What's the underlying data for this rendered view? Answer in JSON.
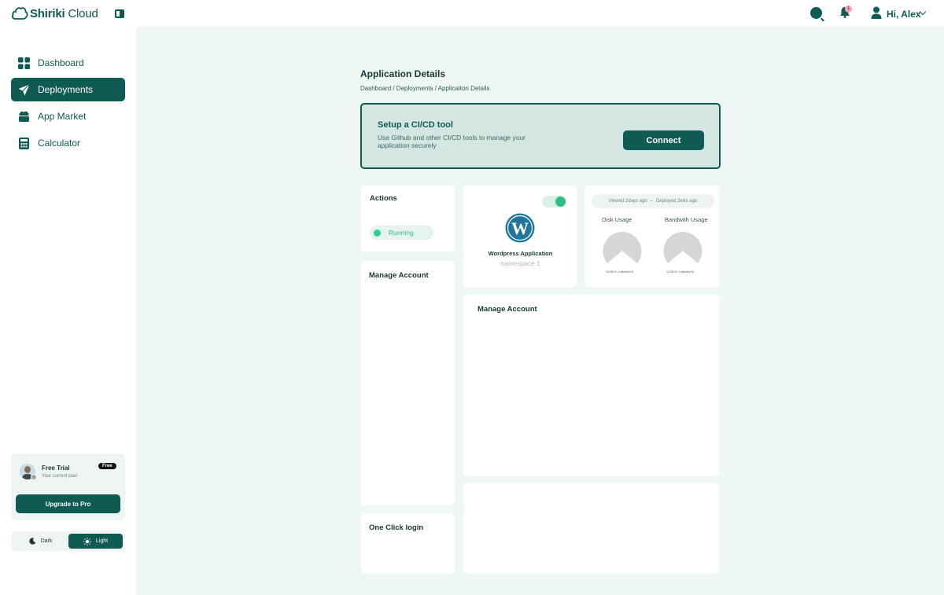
{
  "header": {
    "logo_text_bold": "Shiriki",
    "logo_text_light": " Cloud",
    "notification_count": "1",
    "greeting": "Hi, Alex"
  },
  "sidebar": {
    "items": [
      {
        "label": "Dashboard",
        "icon": "grid-icon",
        "active": false
      },
      {
        "label": "Deployments",
        "icon": "paper-plane-icon",
        "active": true
      },
      {
        "label": "App Market",
        "icon": "cloud-box-icon",
        "active": false
      },
      {
        "label": "Calculator",
        "icon": "calculator-icon",
        "active": false
      }
    ],
    "plan": {
      "name": "Free Trial",
      "subtitle": "Your current plan",
      "badge": "Free",
      "upgrade_label": "Upgrade to Pro"
    },
    "theme": {
      "dark_label": "Dark",
      "light_label": "Light",
      "selected": "Light"
    }
  },
  "page": {
    "title": "Application Details",
    "breadcrumb": "Dashboard / Deployments / Applicaiton Details"
  },
  "cicd": {
    "title": "Setup a  CI/CD tool",
    "description": "Use Github and other CI/CD tools to manage your application securely",
    "button_label": "Connect"
  },
  "actions": {
    "title": "Actions",
    "status": "Running"
  },
  "app": {
    "name": "Wordpress Application",
    "namespace": "namespace 1",
    "enabled": true
  },
  "usage": {
    "viewed": "Viewed 2days ago",
    "separator": "–",
    "deployed": "Deployed  2wks ago",
    "disk_label": "Disk Usage",
    "bandwidth_label": "Bandwith Usage",
    "disk_caption": "11235 M / Unlimited M",
    "bandwidth_caption": "11235 M / Unlimited M"
  },
  "left_cards": {
    "manage_account": "Manage Account",
    "one_click_login": "One Click login"
  },
  "right_cards": {
    "manage_account": "Manage Account"
  },
  "colors": {
    "primary": "#0f5a53",
    "accent_green": "#2fbf83",
    "main_bg": "#eff7f5"
  }
}
